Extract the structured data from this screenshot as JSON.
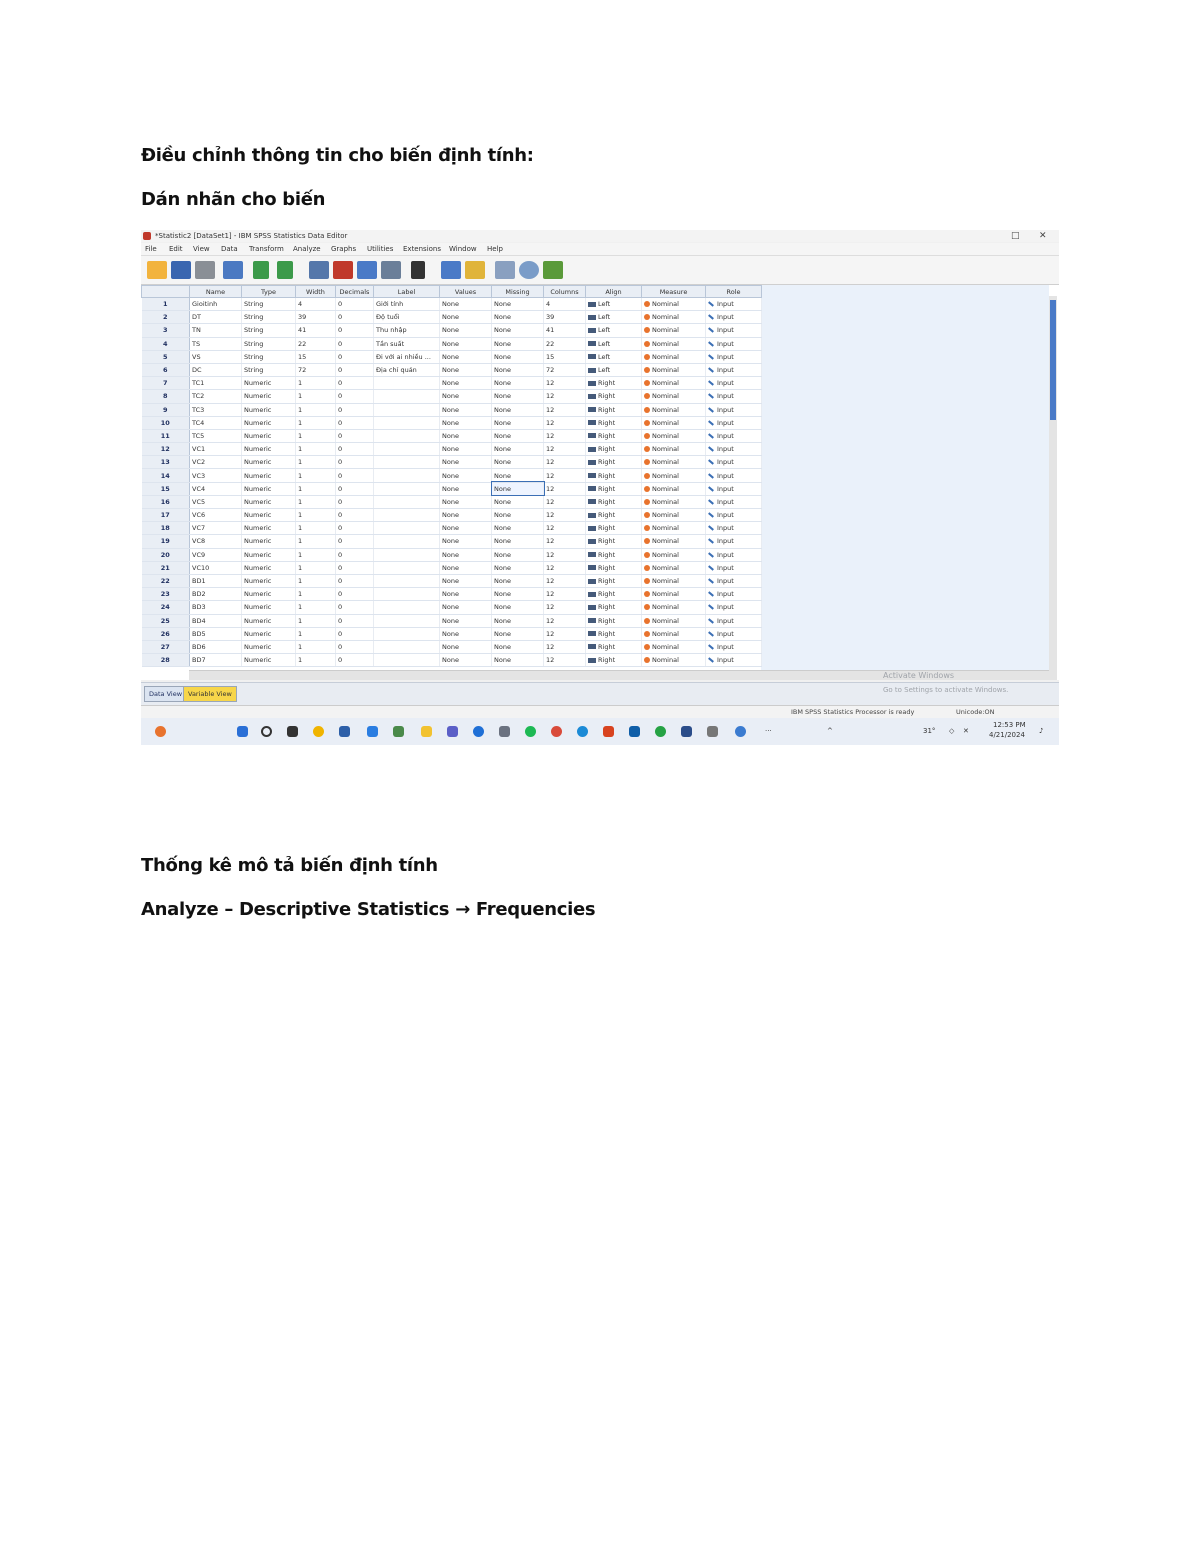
{
  "document": {
    "heading1": "Điều chỉnh thông tin cho biến định tính:",
    "heading2": "Dán nhãn cho biến",
    "heading3": "Thống kê mô tả biến định tính",
    "heading4": "Analyze – Descriptive Statistics → Frequencies"
  },
  "window": {
    "title": "*Statistic2 [DataSet1] - IBM SPSS Statistics Data Editor",
    "menu": [
      "File",
      "Edit",
      "View",
      "Data",
      "Transform",
      "Analyze",
      "Graphs",
      "Utilities",
      "Extensions",
      "Window",
      "Help"
    ]
  },
  "table": {
    "columns": [
      "Name",
      "Type",
      "Width",
      "Decimals",
      "Label",
      "Values",
      "Missing",
      "Columns",
      "Align",
      "Measure",
      "Role"
    ],
    "rows": [
      {
        "n": "1",
        "name": "Gioitinh",
        "type": "String",
        "width": "4",
        "dec": "0",
        "label": "Giới tính",
        "values": "None",
        "missing": "None",
        "columns": "4",
        "align": "Left",
        "measure": "Nominal",
        "role": "Input"
      },
      {
        "n": "2",
        "name": "DT",
        "type": "String",
        "width": "39",
        "dec": "0",
        "label": "Độ tuổi",
        "values": "None",
        "missing": "None",
        "columns": "39",
        "align": "Left",
        "measure": "Nominal",
        "role": "Input"
      },
      {
        "n": "3",
        "name": "TN",
        "type": "String",
        "width": "41",
        "dec": "0",
        "label": "Thu nhập",
        "values": "None",
        "missing": "None",
        "columns": "41",
        "align": "Left",
        "measure": "Nominal",
        "role": "Input"
      },
      {
        "n": "4",
        "name": "TS",
        "type": "String",
        "width": "22",
        "dec": "0",
        "label": "Tần suất",
        "values": "None",
        "missing": "None",
        "columns": "22",
        "align": "Left",
        "measure": "Nominal",
        "role": "Input"
      },
      {
        "n": "5",
        "name": "VS",
        "type": "String",
        "width": "15",
        "dec": "0",
        "label": "Đi với ai nhiều ...",
        "values": "None",
        "missing": "None",
        "columns": "15",
        "align": "Left",
        "measure": "Nominal",
        "role": "Input"
      },
      {
        "n": "6",
        "name": "DC",
        "type": "String",
        "width": "72",
        "dec": "0",
        "label": "Địa chỉ quán",
        "values": "None",
        "missing": "None",
        "columns": "72",
        "align": "Left",
        "measure": "Nominal",
        "role": "Input"
      },
      {
        "n": "7",
        "name": "TC1",
        "type": "Numeric",
        "width": "1",
        "dec": "0",
        "label": "",
        "values": "None",
        "missing": "None",
        "columns": "12",
        "align": "Right",
        "measure": "Nominal",
        "role": "Input"
      },
      {
        "n": "8",
        "name": "TC2",
        "type": "Numeric",
        "width": "1",
        "dec": "0",
        "label": "",
        "values": "None",
        "missing": "None",
        "columns": "12",
        "align": "Right",
        "measure": "Nominal",
        "role": "Input"
      },
      {
        "n": "9",
        "name": "TC3",
        "type": "Numeric",
        "width": "1",
        "dec": "0",
        "label": "",
        "values": "None",
        "missing": "None",
        "columns": "12",
        "align": "Right",
        "measure": "Nominal",
        "role": "Input"
      },
      {
        "n": "10",
        "name": "TC4",
        "type": "Numeric",
        "width": "1",
        "dec": "0",
        "label": "",
        "values": "None",
        "missing": "None",
        "columns": "12",
        "align": "Right",
        "measure": "Nominal",
        "role": "Input"
      },
      {
        "n": "11",
        "name": "TC5",
        "type": "Numeric",
        "width": "1",
        "dec": "0",
        "label": "",
        "values": "None",
        "missing": "None",
        "columns": "12",
        "align": "Right",
        "measure": "Nominal",
        "role": "Input"
      },
      {
        "n": "12",
        "name": "VC1",
        "type": "Numeric",
        "width": "1",
        "dec": "0",
        "label": "",
        "values": "None",
        "missing": "None",
        "columns": "12",
        "align": "Right",
        "measure": "Nominal",
        "role": "Input"
      },
      {
        "n": "13",
        "name": "VC2",
        "type": "Numeric",
        "width": "1",
        "dec": "0",
        "label": "",
        "values": "None",
        "missing": "None",
        "columns": "12",
        "align": "Right",
        "measure": "Nominal",
        "role": "Input"
      },
      {
        "n": "14",
        "name": "VC3",
        "type": "Numeric",
        "width": "1",
        "dec": "0",
        "label": "",
        "values": "None",
        "missing": "None",
        "columns": "12",
        "align": "Right",
        "measure": "Nominal",
        "role": "Input"
      },
      {
        "n": "15",
        "name": "VC4",
        "type": "Numeric",
        "width": "1",
        "dec": "0",
        "label": "",
        "values": "None",
        "missing": "None",
        "columns": "12",
        "align": "Right",
        "measure": "Nominal",
        "role": "Input"
      },
      {
        "n": "16",
        "name": "VC5",
        "type": "Numeric",
        "width": "1",
        "dec": "0",
        "label": "",
        "values": "None",
        "missing": "None",
        "columns": "12",
        "align": "Right",
        "measure": "Nominal",
        "role": "Input"
      },
      {
        "n": "17",
        "name": "VC6",
        "type": "Numeric",
        "width": "1",
        "dec": "0",
        "label": "",
        "values": "None",
        "missing": "None",
        "columns": "12",
        "align": "Right",
        "measure": "Nominal",
        "role": "Input"
      },
      {
        "n": "18",
        "name": "VC7",
        "type": "Numeric",
        "width": "1",
        "dec": "0",
        "label": "",
        "values": "None",
        "missing": "None",
        "columns": "12",
        "align": "Right",
        "measure": "Nominal",
        "role": "Input"
      },
      {
        "n": "19",
        "name": "VC8",
        "type": "Numeric",
        "width": "1",
        "dec": "0",
        "label": "",
        "values": "None",
        "missing": "None",
        "columns": "12",
        "align": "Right",
        "measure": "Nominal",
        "role": "Input"
      },
      {
        "n": "20",
        "name": "VC9",
        "type": "Numeric",
        "width": "1",
        "dec": "0",
        "label": "",
        "values": "None",
        "missing": "None",
        "columns": "12",
        "align": "Right",
        "measure": "Nominal",
        "role": "Input"
      },
      {
        "n": "21",
        "name": "VC10",
        "type": "Numeric",
        "width": "1",
        "dec": "0",
        "label": "",
        "values": "None",
        "missing": "None",
        "columns": "12",
        "align": "Right",
        "measure": "Nominal",
        "role": "Input"
      },
      {
        "n": "22",
        "name": "BD1",
        "type": "Numeric",
        "width": "1",
        "dec": "0",
        "label": "",
        "values": "None",
        "missing": "None",
        "columns": "12",
        "align": "Right",
        "measure": "Nominal",
        "role": "Input"
      },
      {
        "n": "23",
        "name": "BD2",
        "type": "Numeric",
        "width": "1",
        "dec": "0",
        "label": "",
        "values": "None",
        "missing": "None",
        "columns": "12",
        "align": "Right",
        "measure": "Nominal",
        "role": "Input"
      },
      {
        "n": "24",
        "name": "BD3",
        "type": "Numeric",
        "width": "1",
        "dec": "0",
        "label": "",
        "values": "None",
        "missing": "None",
        "columns": "12",
        "align": "Right",
        "measure": "Nominal",
        "role": "Input"
      },
      {
        "n": "25",
        "name": "BD4",
        "type": "Numeric",
        "width": "1",
        "dec": "0",
        "label": "",
        "values": "None",
        "missing": "None",
        "columns": "12",
        "align": "Right",
        "measure": "Nominal",
        "role": "Input"
      },
      {
        "n": "26",
        "name": "BD5",
        "type": "Numeric",
        "width": "1",
        "dec": "0",
        "label": "",
        "values": "None",
        "missing": "None",
        "columns": "12",
        "align": "Right",
        "measure": "Nominal",
        "role": "Input"
      },
      {
        "n": "27",
        "name": "BD6",
        "type": "Numeric",
        "width": "1",
        "dec": "0",
        "label": "",
        "values": "None",
        "missing": "None",
        "columns": "12",
        "align": "Right",
        "measure": "Nominal",
        "role": "Input"
      },
      {
        "n": "28",
        "name": "BD7",
        "type": "Numeric",
        "width": "1",
        "dec": "0",
        "label": "",
        "values": "None",
        "missing": "None",
        "columns": "12",
        "align": "Right",
        "measure": "Nominal",
        "role": "Input"
      }
    ]
  },
  "tabs": {
    "data_view": "Data View",
    "variable_view": "Variable View"
  },
  "watermark": {
    "line1": "Activate Windows",
    "line2": "Go to Settings to activate Windows."
  },
  "status": {
    "processor": "IBM SPSS Statistics Processor is ready",
    "unicode": "Unicode:ON"
  },
  "taskbar": {
    "time": "12:53 PM",
    "date": "4/21/2024",
    "temp": "31°"
  }
}
